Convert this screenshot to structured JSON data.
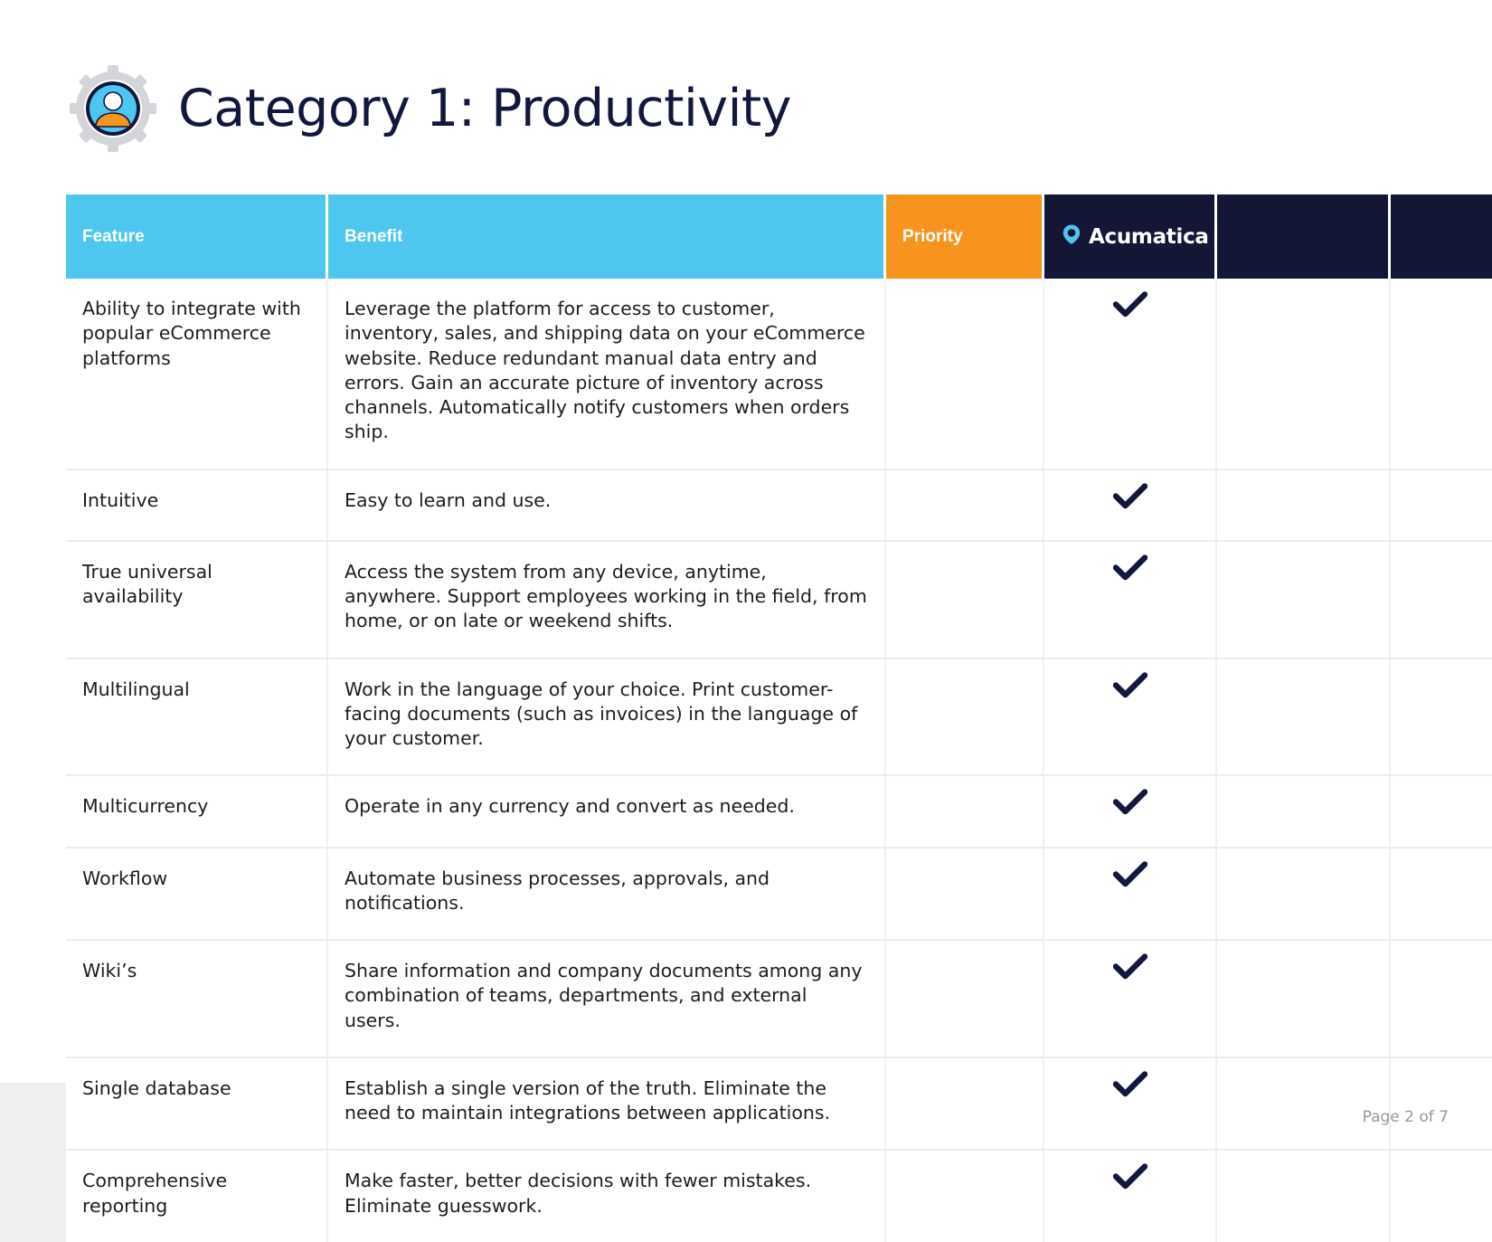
{
  "document": {
    "title": "Category 1: Productivity",
    "header_icon": "productivity-gear-person-icon",
    "footer": "Page 2 of 7"
  },
  "colors": {
    "header_cyan": "#4ec6f0",
    "header_orange": "#f7941e",
    "header_navy": "#131735",
    "title_navy": "#12173c",
    "page_background": "#efefef",
    "accent_icon_orange": "#f7941e"
  },
  "table": {
    "columns": [
      {
        "key": "feature",
        "label": "Feature",
        "style": "cyan"
      },
      {
        "key": "benefit",
        "label": "Benefit",
        "style": "cyan"
      },
      {
        "key": "priority",
        "label": "Priority",
        "style": "orange"
      },
      {
        "key": "vendor",
        "label": "Acumatica",
        "style": "navy",
        "icon": "acumatica-logo-icon"
      },
      {
        "key": "blank1",
        "label": "",
        "style": "navy"
      },
      {
        "key": "blank2",
        "label": "",
        "style": "navy"
      }
    ],
    "check_glyph": "check-icon",
    "rows": [
      {
        "feature": "Ability to integrate with popular eCommerce platforms",
        "benefit": "Leverage the platform for access to customer, inventory, sales, and shipping data on your eCommerce website. Reduce redundant manual data entry and errors. Gain an accurate picture of inventory across channels. Automatically notify customers when orders ship.",
        "priority": "",
        "vendor": "check",
        "blank1": "",
        "blank2": ""
      },
      {
        "feature": "Intuitive",
        "benefit": "Easy to learn and use.",
        "priority": "",
        "vendor": "check",
        "blank1": "",
        "blank2": ""
      },
      {
        "feature": "True universal availability",
        "benefit": "Access the system from any device, anytime, anywhere. Support employees working in the field, from home, or on late or weekend shifts.",
        "priority": "",
        "vendor": "check",
        "blank1": "",
        "blank2": ""
      },
      {
        "feature": "Multilingual",
        "benefit": "Work in the language of your choice. Print customer-facing documents (such as invoices) in the language of your customer.",
        "priority": "",
        "vendor": "check",
        "blank1": "",
        "blank2": ""
      },
      {
        "feature": "Multicurrency",
        "benefit": "Operate in any currency and convert as needed.",
        "priority": "",
        "vendor": "check",
        "blank1": "",
        "blank2": ""
      },
      {
        "feature": "Workflow",
        "benefit": "Automate business processes, approvals, and notifications.",
        "priority": "",
        "vendor": "check",
        "blank1": "",
        "blank2": ""
      },
      {
        "feature": "Wiki’s",
        "benefit": "Share information and company documents among any combination of teams, departments, and external users.",
        "priority": "",
        "vendor": "check",
        "blank1": "",
        "blank2": ""
      },
      {
        "feature": "Single database",
        "benefit": "Establish a single version of the truth. Eliminate the need to maintain integrations between applications.",
        "priority": "",
        "vendor": "check",
        "blank1": "",
        "blank2": ""
      },
      {
        "feature": "Comprehensive reporting",
        "benefit": "Make faster, better decisions with fewer mistakes. Eliminate guesswork.",
        "priority": "",
        "vendor": "check",
        "blank1": "",
        "blank2": ""
      }
    ]
  }
}
